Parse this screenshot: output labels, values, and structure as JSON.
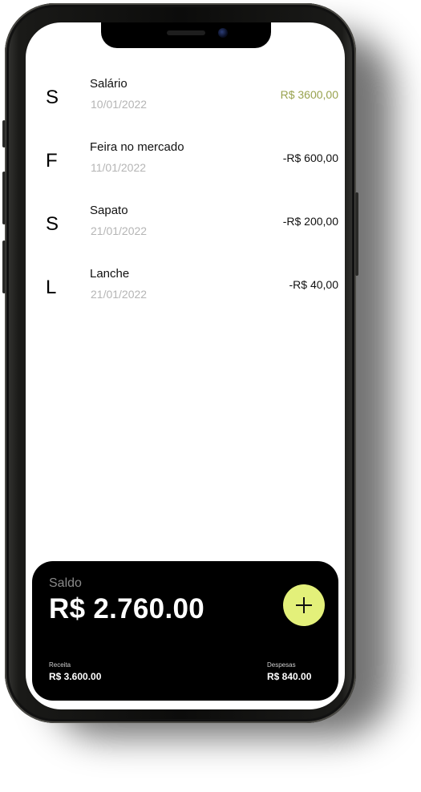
{
  "transactions": [
    {
      "initial": "S",
      "title": "Salário",
      "date": "10/01/2022",
      "amount": "R$ 3600,00",
      "type": "income"
    },
    {
      "initial": "F",
      "title": "Feira no mercado",
      "date": "11/01/2022",
      "amount": "-R$ 600,00",
      "type": "expense"
    },
    {
      "initial": "S",
      "title": "Sapato",
      "date": "21/01/2022",
      "amount": "-R$ 200,00",
      "type": "expense"
    },
    {
      "initial": "L",
      "title": "Lanche",
      "date": "21/01/2022",
      "amount": "-R$ 40,00",
      "type": "expense"
    }
  ],
  "balance": {
    "label": "Saldo",
    "value": "R$ 2.760.00",
    "income_label": "Receita",
    "income_value": "R$ 3.600.00",
    "expense_label": "Despesas",
    "expense_value": "R$ 840.00",
    "add_icon": "plus-icon"
  },
  "colors": {
    "income_amount": "#98a24e",
    "date_text": "#b5b5b5",
    "add_button": "#e3f07a",
    "card_background": "#000000"
  }
}
